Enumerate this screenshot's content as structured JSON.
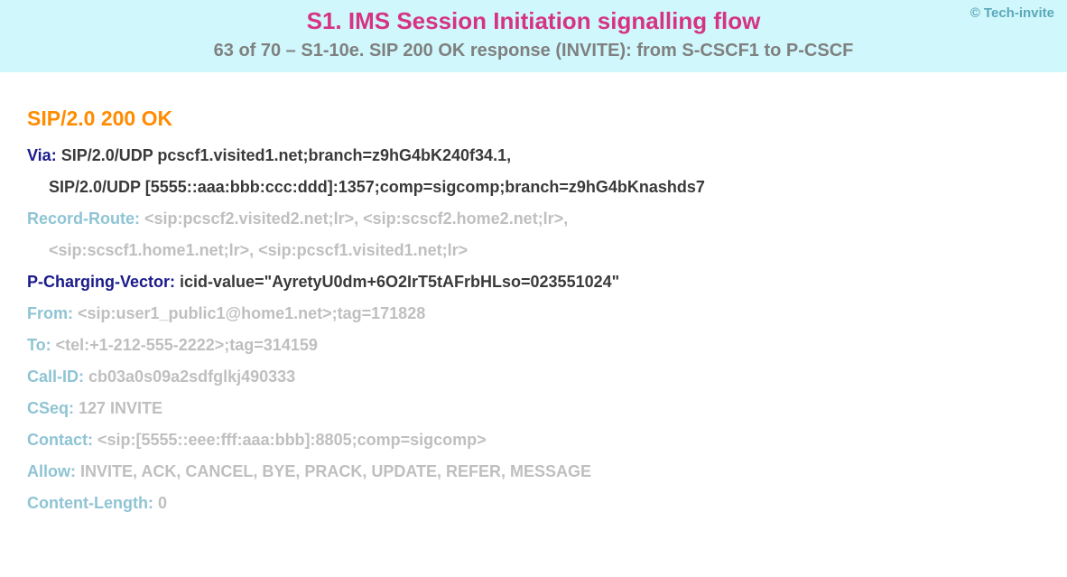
{
  "copyright": "© Tech-invite",
  "title": "S1. IMS Session Initiation signalling flow",
  "subtitle": "63 of 70 – S1-10e. SIP 200 OK response (INVITE): from S-CSCF1 to P-CSCF",
  "status_line": "SIP/2.0 200 OK",
  "headers": {
    "via": {
      "name": "Via",
      "line1": "SIP/2.0/UDP pcscf1.visited1.net;branch=z9hG4bK240f34.1,",
      "line2": "SIP/2.0/UDP [5555::aaa:bbb:ccc:ddd]:1357;comp=sigcomp;branch=z9hG4bKnashds7"
    },
    "record_route": {
      "name": "Record-Route",
      "line1": "<sip:pcscf2.visited2.net;lr>, <sip:scscf2.home2.net;lr>,",
      "line2": "<sip:scscf1.home1.net;lr>, <sip:pcscf1.visited1.net;lr>"
    },
    "p_charging_vector": {
      "name": "P-Charging-Vector",
      "value": "icid-value=\"AyretyU0dm+6O2IrT5tAFrbHLso=023551024\""
    },
    "from": {
      "name": "From",
      "value": "<sip:user1_public1@home1.net>;tag=171828"
    },
    "to": {
      "name": "To",
      "value": "<tel:+1-212-555-2222>;tag=314159"
    },
    "call_id": {
      "name": "Call-ID",
      "value": "cb03a0s09a2sdfglkj490333"
    },
    "cseq": {
      "name": "CSeq",
      "value": "127 INVITE"
    },
    "contact": {
      "name": "Contact",
      "value": "<sip:[5555::eee:fff:aaa:bbb]:8805;comp=sigcomp>"
    },
    "allow": {
      "name": "Allow",
      "value": "INVITE, ACK, CANCEL, BYE, PRACK, UPDATE, REFER, MESSAGE"
    },
    "content_length": {
      "name": "Content-Length",
      "value": "0"
    }
  }
}
